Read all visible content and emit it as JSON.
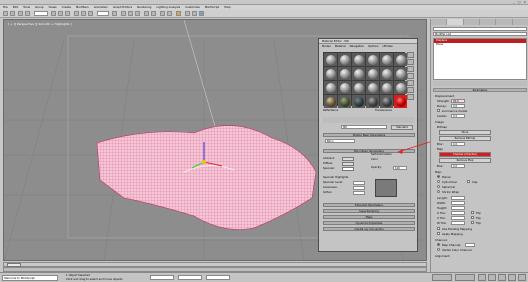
{
  "menu": [
    "File",
    "Edit",
    "Tools",
    "Group",
    "Views",
    "Create",
    "Modifiers",
    "Animation",
    "Graph Editors",
    "Rendering",
    "Lighting Analysis",
    "Customize",
    "MAXScript",
    "Help"
  ],
  "viewport": {
    "label": "[ + ][ Perspective ][ Smooth + Highlights ]"
  },
  "material_editor": {
    "title": "Material Editor - Mtl",
    "menu": [
      "Modes",
      "Material",
      "Navigation",
      "Options",
      "Utilities"
    ],
    "reflectance_label": "Reflectance",
    "translucence_label": "Translucence",
    "material_name": "Mtl",
    "standard_label": "Standard",
    "shader_basic": "Shader Basic Parameters",
    "shader_value": "Blinn",
    "blinn_basic": "Blinn Basic Parameters",
    "ambient": "Ambient:",
    "diffuse": "Diffuse:",
    "specular": "Specular:",
    "self_illum": "Self-Illumination",
    "color": "Color",
    "opacity": "Opacity:",
    "opacity_value": "100",
    "specular_highlights": "Specular Highlights",
    "specular_level": "Specular Level:",
    "glossiness": "Glossiness:",
    "soften": "Soften:",
    "rollouts": [
      "Extended Parameters",
      "SuperSampling",
      "Maps",
      "Dynamics Properties",
      "mental ray Connection"
    ]
  },
  "command_panel": {
    "modifier_list": "Modifier List",
    "stack": [
      "Displace",
      "Plane"
    ],
    "parameters": "Parameters",
    "displacement": "Displacement",
    "strength_label": "Strength:",
    "strength_value": "20.0",
    "decay_label": "Decay:",
    "decay_value": "0.0",
    "luminance_center": "Luminance Center",
    "center_label": "Center:",
    "center_value": "0.5",
    "image_label": "Image",
    "bitmap_label": "Bitmap",
    "bitmap_button": "None",
    "remove_bitmap": "Remove Bitmap",
    "blur_label": "Blur:",
    "blur_value": "0.0",
    "map_label": "Map",
    "map_button": "Checker (Checker)",
    "remove_map": "Remove Map",
    "map_blur_value": "0.0",
    "map_section": "Map:",
    "planar": "Planar",
    "cylindrical": "Cylindrical",
    "cap": "Cap",
    "spherical": "Spherical",
    "shrink_wrap": "Shrink Wrap",
    "length": "Length:",
    "width": "Width:",
    "height": "Height:",
    "u_tile": "U Tile:",
    "v_tile": "V Tile:",
    "w_tile": "W Tile:",
    "flip": "Flip",
    "use_existing": "Use Existing Mapping",
    "apply_mapping": "Apply Mapping",
    "channel": "Channel:",
    "map_channel": "Map Channel:",
    "vertex_color": "Vertex Color Channel",
    "alignment": "Alignment:"
  },
  "timebar": {
    "label": "0 / 100"
  },
  "status": {
    "selected": "1 Object Selected",
    "hint": "Click and drag to select and move objects",
    "welcome": "Welcome to MAXScript."
  },
  "colors": {
    "accent_red": "#d61e1e",
    "mesh_pink": "#f4c6d6",
    "viewport_bg": "#8d8d8d"
  }
}
